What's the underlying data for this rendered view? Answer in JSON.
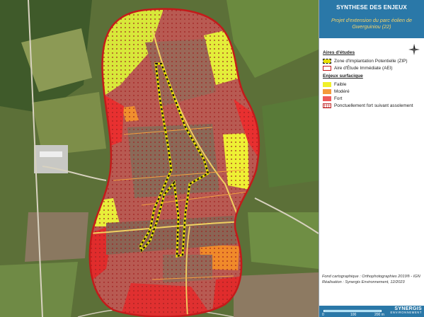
{
  "panel": {
    "title": "SYNTHESE DES ENJEUX",
    "subtitle": "Projet d'extension du parc éolien de Gwerguiniou (22)"
  },
  "legend": {
    "study_areas_title": "Aires d'études",
    "zip_label": "Zone d'Implantation Potentielle (ZIP)",
    "aei_label": "Aire d'Étude Immédiate (AEI)",
    "surface_title": "Enjeux surfacique",
    "levels": [
      {
        "label": "Faible",
        "color": "#f0f02a"
      },
      {
        "label": "Modéré",
        "color": "#f49a3a"
      },
      {
        "label": "Fort",
        "color": "#ee5a5a"
      }
    ],
    "dots_label": "Ponctuellement fort suivant assolement"
  },
  "credits": {
    "line1": "Fond cartographique : Orthophotographies 2019® - IGN",
    "line2": "Réalisation : Synergis Environnement, 12/2023"
  },
  "scale": {
    "start": "0",
    "mid": "100",
    "end": "200 m"
  },
  "logo": {
    "name": "SYNERGIS",
    "tagline": "ENVIRONNEMENT"
  },
  "colors": {
    "header": "#2a78a8",
    "aei_outline": "#c41a1a",
    "zip_outline": "#111111",
    "zip_fill": "#e8e000",
    "dots": "#a02020"
  },
  "icons": {
    "compass": "north-compass-icon"
  }
}
